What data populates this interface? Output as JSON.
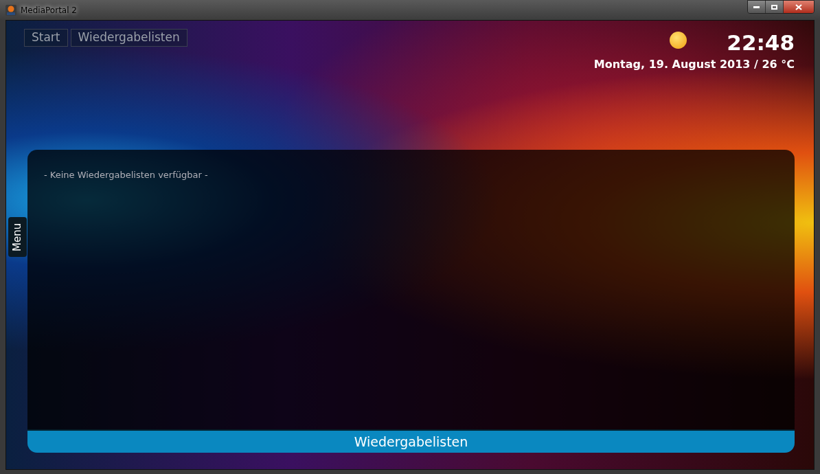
{
  "window": {
    "title": "MediaPortal 2"
  },
  "breadcrumb": [
    {
      "label": "Start"
    },
    {
      "label": "Wiedergabelisten"
    }
  ],
  "clock": {
    "time": "22:48",
    "date": "Montag, 19. August 2013 / 26 °C"
  },
  "side_menu": {
    "label": "Menu"
  },
  "panel": {
    "empty_message": "- Keine Wiedergabelisten verfügbar -",
    "footer_title": "Wiedergabelisten"
  }
}
